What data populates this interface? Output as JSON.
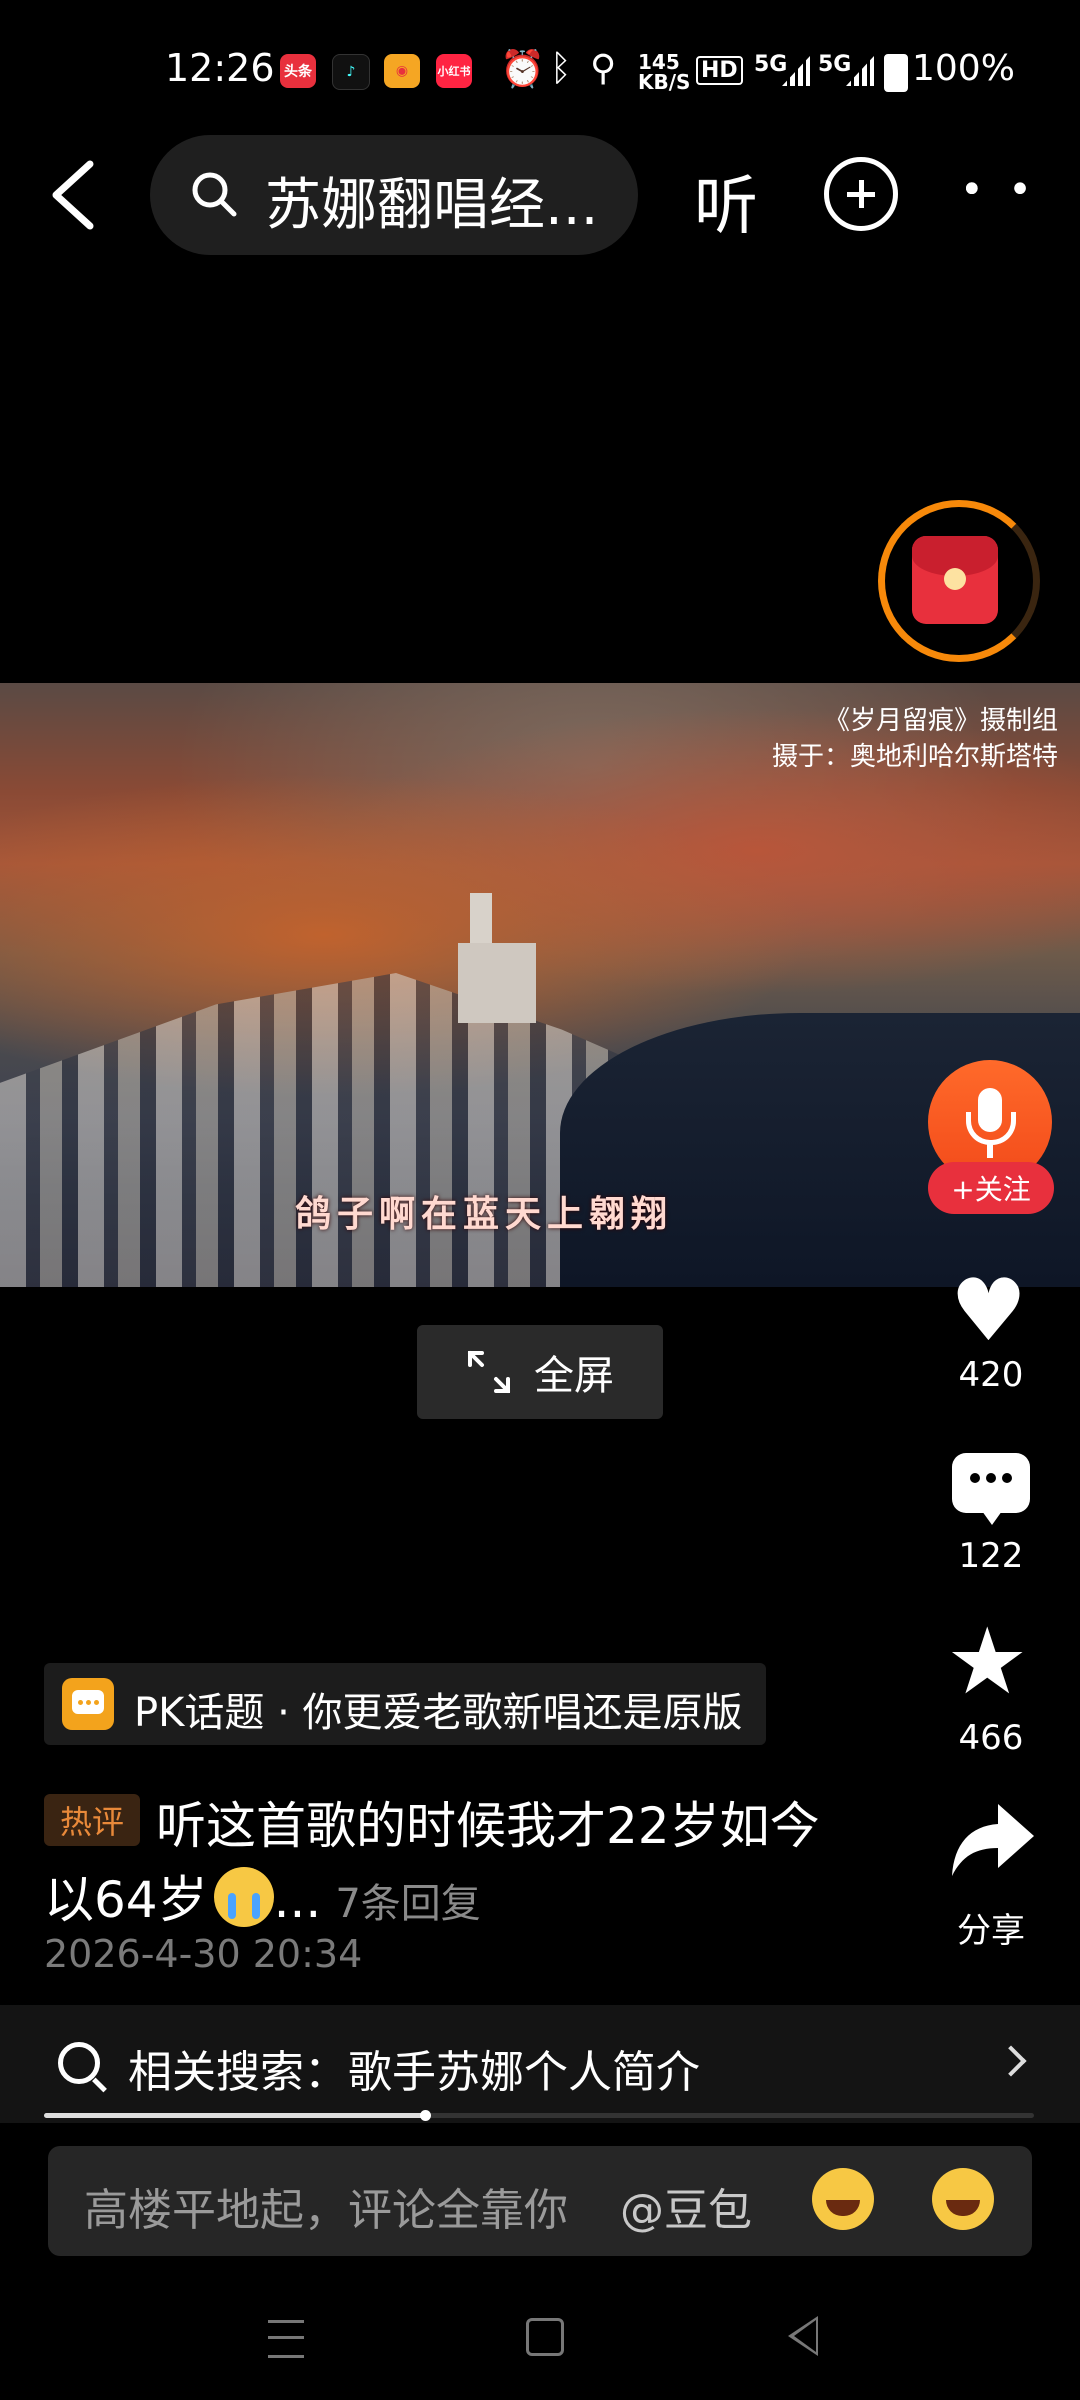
{
  "status_bar": {
    "time": "12:26",
    "net_speed": "145\nKB/S",
    "hd": "HD",
    "signal1": "5G",
    "signal2": "5G",
    "battery": "100%",
    "apps": [
      {
        "name": "头条",
        "color": "#e8303d"
      },
      {
        "name": "抖音",
        "color": "#111111"
      },
      {
        "name": "微博",
        "color": "#f5a623"
      },
      {
        "name": "小红书",
        "color": "#ff2442"
      }
    ]
  },
  "top_bar": {
    "search_text": "苏娜翻唱经...",
    "listen_label": "听"
  },
  "video": {
    "credit_line1": "《岁月留痕》摄制组",
    "credit_line2": "摄于：奥地利哈尔斯塔特",
    "subtitle": "鸽子啊在蓝天上翱翔"
  },
  "fullscreen_label": "全屏",
  "actions": {
    "follow_label": "+关注",
    "likes": "420",
    "comments": "122",
    "favorites": "466",
    "share_label": "分享"
  },
  "topic": {
    "text": "PK话题 · 你更爱老歌新唱还是原版"
  },
  "comment": {
    "badge": "热评",
    "line1": "听这首歌的时候我才22岁如今",
    "line2": "以64岁",
    "ellipsis": "...",
    "replies": "7条回复",
    "date": "2026-4-30 20:34"
  },
  "related_search": {
    "text": "相关搜索：歌手苏娜个人简介",
    "progress": 0.385
  },
  "input": {
    "placeholder": "高楼平地起，评论全靠你",
    "mention": "@豆包"
  },
  "colors": {
    "accent_orange": "#f7890a",
    "red": "#e8303d"
  }
}
